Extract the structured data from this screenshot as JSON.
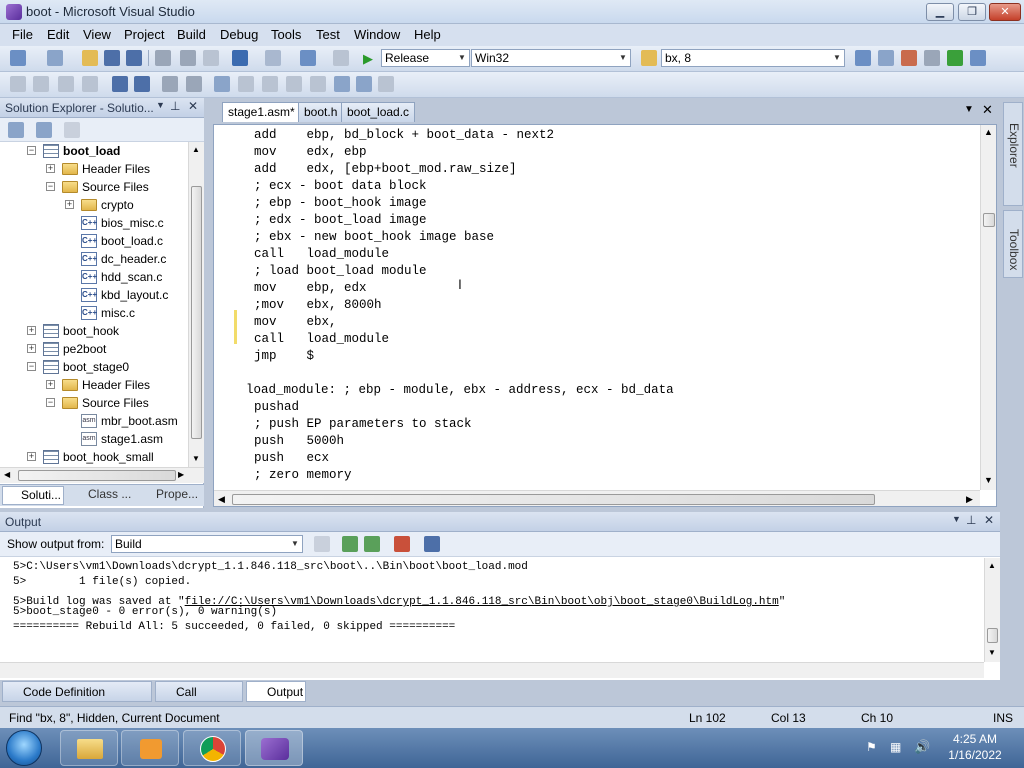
{
  "window": {
    "title": "boot - Microsoft Visual Studio"
  },
  "menu": [
    "File",
    "Edit",
    "View",
    "Project",
    "Build",
    "Debug",
    "Tools",
    "Test",
    "Window",
    "Help"
  ],
  "toolbar": {
    "config": "Release",
    "platform": "Win32",
    "find_value": "bx, 8"
  },
  "solution_explorer": {
    "title": "Solution Explorer - Solutio...",
    "items": [
      {
        "label": "boot_load",
        "bold": true,
        "indent": 0,
        "icon": "project-icon",
        "exp": "−"
      },
      {
        "label": "Header Files",
        "indent": 1,
        "icon": "folder-icon",
        "exp": "+"
      },
      {
        "label": "Source Files",
        "indent": 1,
        "icon": "folder-icon",
        "exp": "−"
      },
      {
        "label": "crypto",
        "indent": 2,
        "icon": "folder-icon",
        "exp": "+"
      },
      {
        "label": "bios_misc.c",
        "indent": 2,
        "icon": "c-file-icon",
        "exp": ""
      },
      {
        "label": "boot_load.c",
        "indent": 2,
        "icon": "c-file-icon",
        "exp": ""
      },
      {
        "label": "dc_header.c",
        "indent": 2,
        "icon": "c-file-icon",
        "exp": ""
      },
      {
        "label": "hdd_scan.c",
        "indent": 2,
        "icon": "c-file-icon",
        "exp": ""
      },
      {
        "label": "kbd_layout.c",
        "indent": 2,
        "icon": "c-file-icon",
        "exp": ""
      },
      {
        "label": "misc.c",
        "indent": 2,
        "icon": "c-file-icon",
        "exp": ""
      },
      {
        "label": "boot_hook",
        "indent": 0,
        "icon": "project-icon",
        "exp": "+"
      },
      {
        "label": "pe2boot",
        "indent": 0,
        "icon": "project-icon",
        "exp": "+"
      },
      {
        "label": "boot_stage0",
        "indent": 0,
        "icon": "project-icon",
        "exp": "−"
      },
      {
        "label": "Header Files",
        "indent": 1,
        "icon": "folder-icon",
        "exp": "+"
      },
      {
        "label": "Source Files",
        "indent": 1,
        "icon": "folder-icon",
        "exp": "−"
      },
      {
        "label": "mbr_boot.asm",
        "indent": 2,
        "icon": "asm-file-icon",
        "exp": ""
      },
      {
        "label": "stage1.asm",
        "indent": 2,
        "icon": "asm-file-icon",
        "exp": ""
      },
      {
        "label": "boot_hook_small",
        "indent": 0,
        "icon": "project-icon",
        "exp": "+"
      }
    ],
    "bottom_tabs": [
      "Soluti...",
      "Class ...",
      "Prope..."
    ]
  },
  "editor": {
    "tabs": [
      "stage1.asm*",
      "boot.h",
      "boot_load.c"
    ],
    "lines": [
      "add    ebp, bd_block + boot_data - next2",
      "mov    edx, ebp",
      "add    edx, [ebp+boot_mod.raw_size]",
      "; ecx - boot data block",
      "; ebp - boot_hook image",
      "; edx - boot_load image",
      "; ebx - new boot_hook image base",
      "call   load_module",
      "; load boot_load module",
      "mov    ebp, edx",
      ";mov   ebx, 8000h",
      "mov    ebx,",
      "call   load_module",
      "jmp    $",
      "",
      "load_module: ; ebp - module, ebx - address, ecx - bd_data",
      "pushad",
      "; push EP parameters to stack",
      "push   5000h",
      "push   ecx",
      "; zero memory"
    ]
  },
  "side_tabs": [
    "Server Explorer",
    "Toolbox"
  ],
  "output": {
    "title": "Output",
    "show_from_label": "Show output from:",
    "show_from_value": "Build",
    "lines": [
      "5>C:\\Users\\vm1\\Downloads\\dcrypt_1.1.846.118_src\\boot\\..\\Bin\\boot\\boot_load.mod",
      "5>        1 file(s) copied.",
      "5>boot_stage0 - 0 error(s), 0 warning(s)",
      "========== Rebuild All: 5 succeeded, 0 failed, 0 skipped =========="
    ],
    "log_prefix": "5>Build log was saved at \"",
    "log_link": "file://C:\\Users\\vm1\\Downloads\\dcrypt_1.1.846.118_src\\Bin\\boot\\obj\\boot_stage0\\BuildLog.htm",
    "log_suffix": "\""
  },
  "bottom_tabs": [
    "Code Definition Window",
    "Call Browser",
    "Output"
  ],
  "status": {
    "message": "Find \"bx, 8\", Hidden, Current Document",
    "ln": "Ln 102",
    "col": "Col 13",
    "ch": "Ch 10",
    "mode": "INS"
  },
  "taskbar": {
    "time": "4:25 AM",
    "date": "1/16/2022"
  }
}
